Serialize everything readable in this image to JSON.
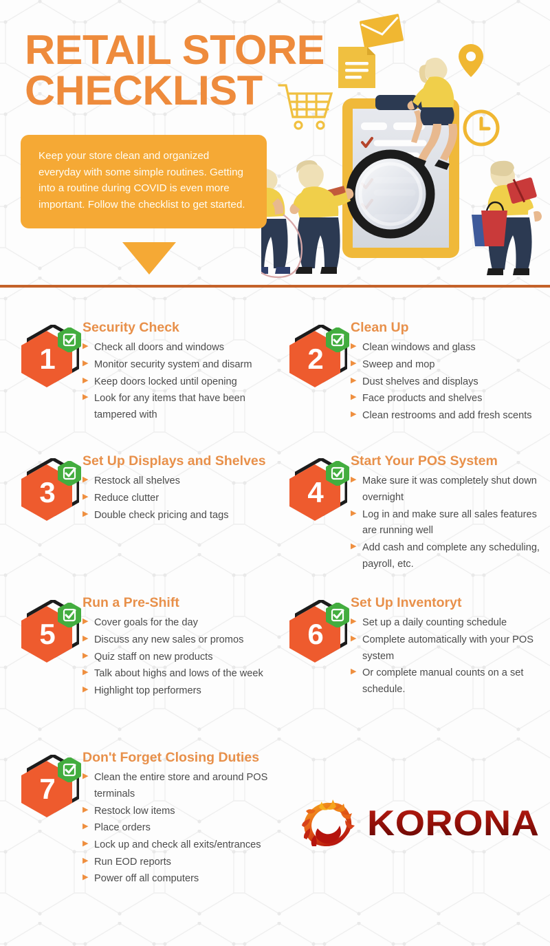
{
  "header": {
    "title_line1": "RETAIL STORE",
    "title_line2": "CHECKLIST",
    "intro": "Keep your store clean and organized everyday with some simple routines. Getting into a routine during COVID is even more important. Follow the checklist to get started.",
    "accent_orange": "#ee8b3c",
    "bubble_orange": "#f5a935",
    "divider_color": "#c4622a"
  },
  "colors": {
    "hex_orange": "#ee5b2e",
    "hex_outline": "#1c1c1c",
    "check_green": "#43ad3f",
    "heading_orange": "#e8904a",
    "bullet_arrow": "#ef8f3f",
    "body_text": "#4b4b4b",
    "logo_red": "#9c1009"
  },
  "logo": {
    "name": "KORONA",
    "icon": "flame-ring-icon"
  },
  "checklist": [
    {
      "number": "1",
      "title": "Security Check",
      "bullets": [
        "Check all doors and windows",
        "Monitor security system and disarm",
        "Keep doors locked until opening",
        "Look for any items that have been tampered with"
      ]
    },
    {
      "number": "2",
      "title": "Clean Up",
      "bullets": [
        "Clean windows and glass",
        "Sweep and mop",
        "Dust shelves and displays",
        "Face products and shelves",
        "Clean restrooms and add fresh scents"
      ]
    },
    {
      "number": "3",
      "title": "Set Up Displays and Shelves",
      "bullets": [
        "Restock all shelves",
        "Reduce clutter",
        "Double check pricing and tags"
      ]
    },
    {
      "number": "4",
      "title": "Start Your POS System",
      "bullets": [
        "Make sure it was completely shut down overnight",
        "Log in and make sure all sales features are running well",
        "Add cash and complete any scheduling, payroll, etc."
      ]
    },
    {
      "number": "5",
      "title": "Run a Pre-Shift",
      "bullets": [
        "Cover goals for the day",
        "Discuss any new sales or promos",
        "Quiz staff on new products",
        "Talk about highs and lows of the week",
        "Highlight top performers"
      ]
    },
    {
      "number": "6",
      "title": "Set Up Inventoryt",
      "bullets": [
        "Set up a daily counting schedule",
        "Complete automatically with your POS system",
        "Or complete manual counts on a set schedule."
      ]
    },
    {
      "number": "7",
      "title": "Don't Forget Closing Duties",
      "bullets": [
        "Clean the entire store and around POS terminals",
        "Restock low items",
        "Place orders",
        "Lock up and check all exits/entrances",
        "Run EOD reports",
        "Power off all computers"
      ]
    }
  ]
}
